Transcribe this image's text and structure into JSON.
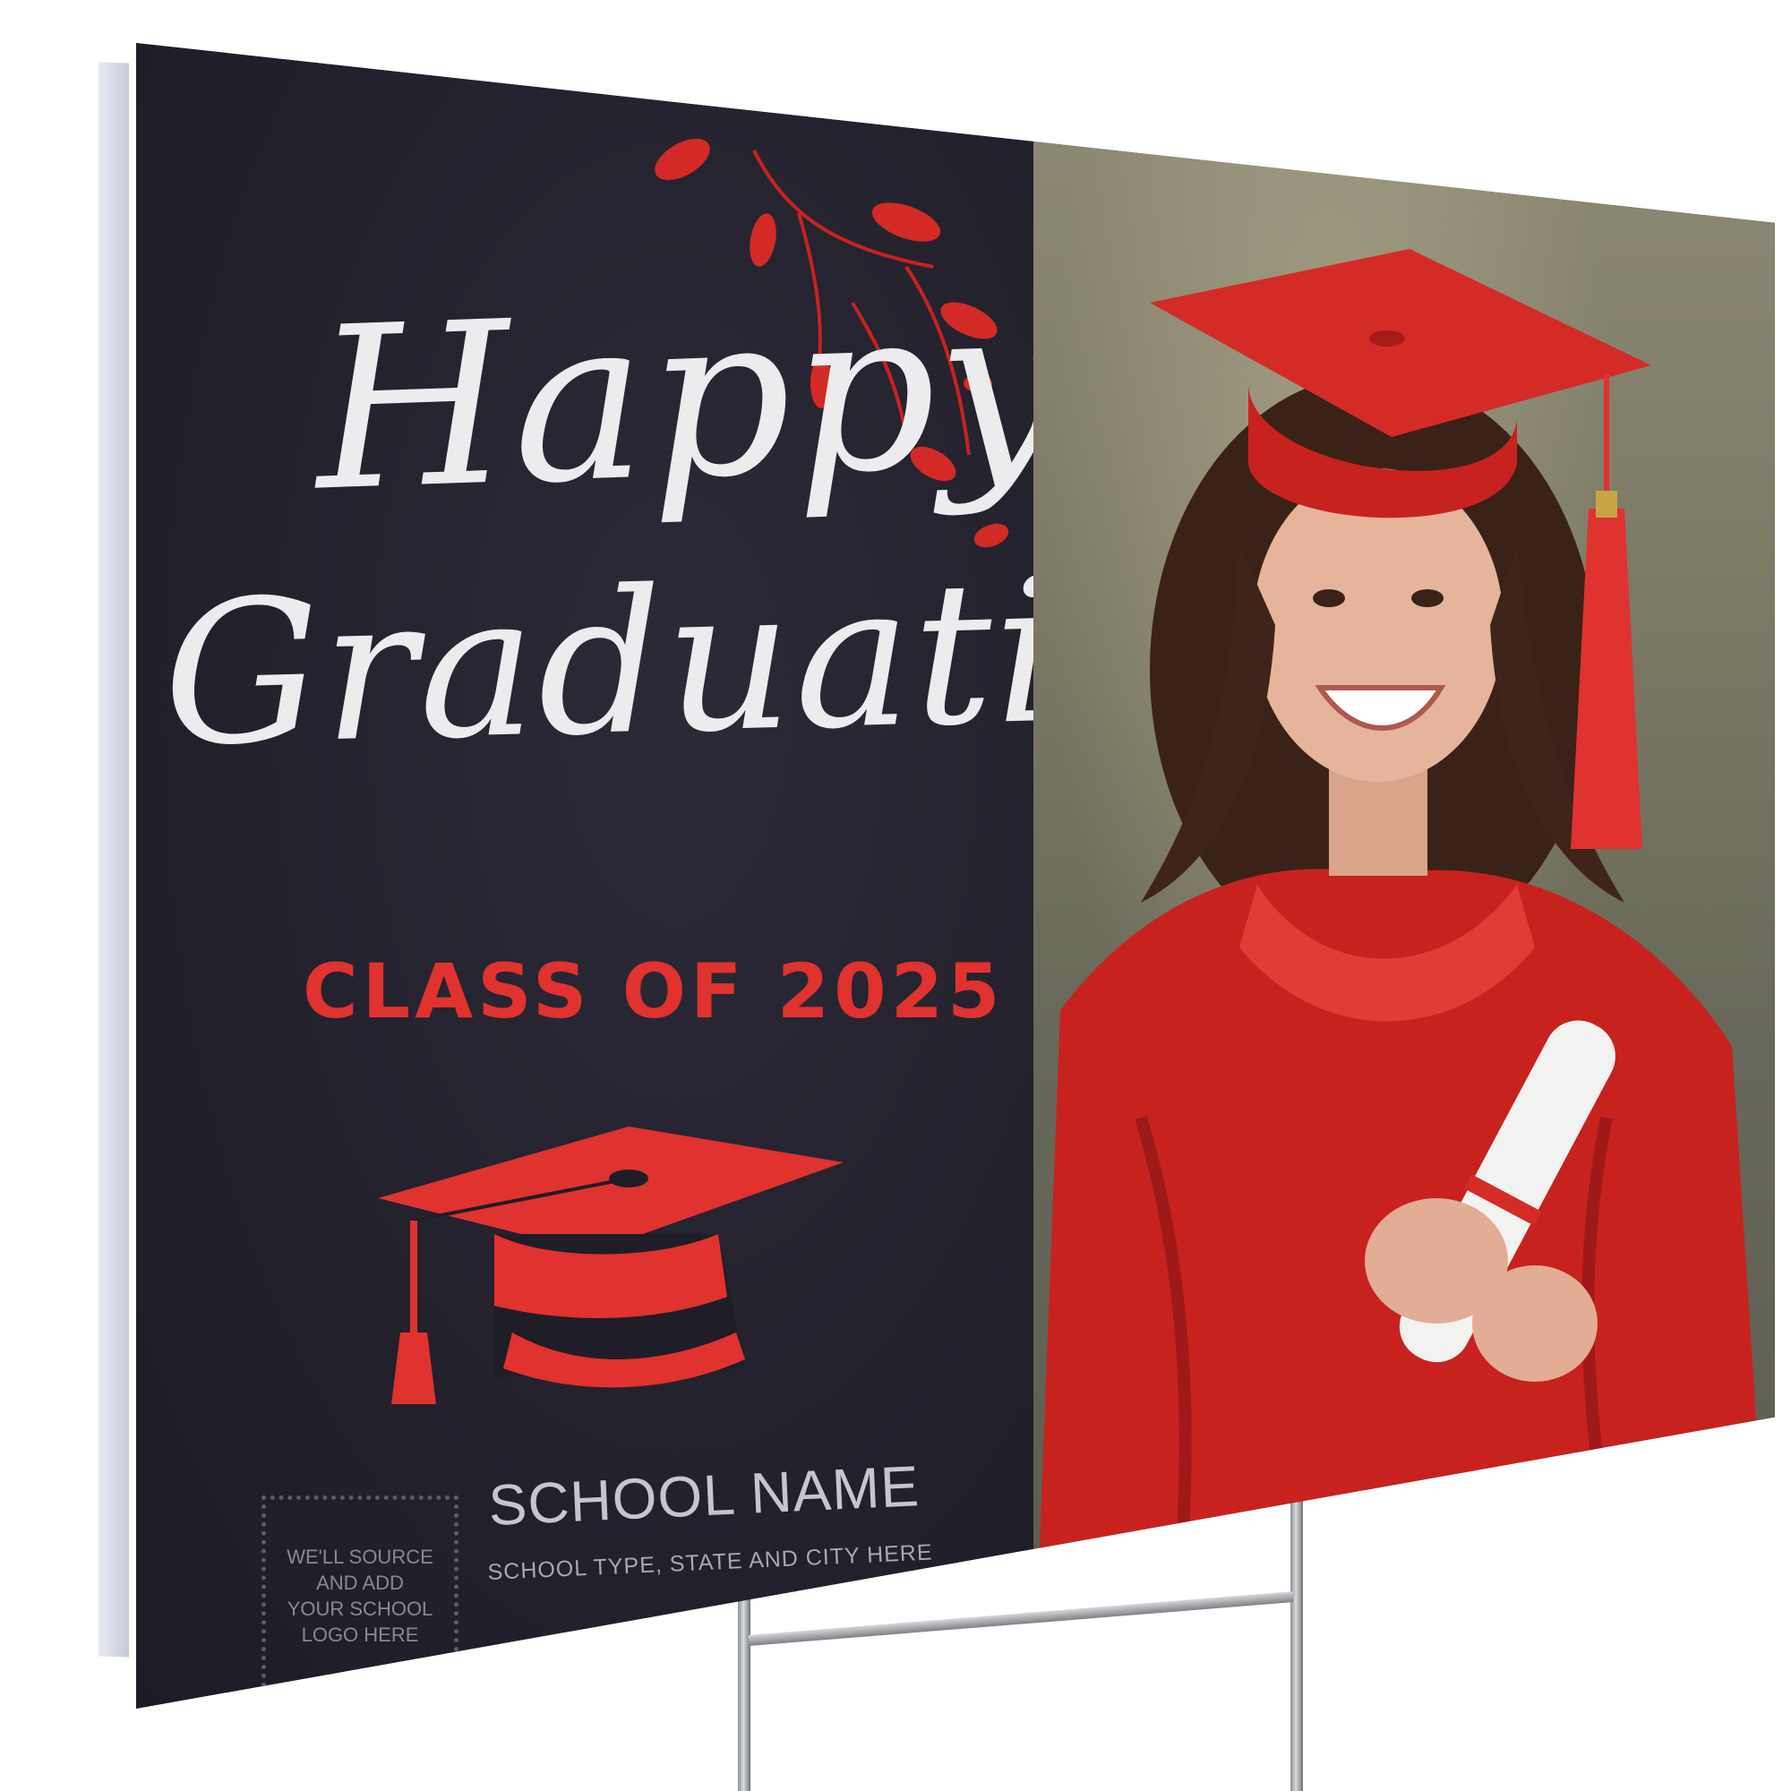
{
  "sign": {
    "headline_line1": "Happy",
    "headline_line2": "Graduation!",
    "class_year": "CLASS OF 2025",
    "logo_placeholder": "WE'LL SOURCE\nAND ADD\nYOUR SCHOOL\nLOGO HERE",
    "school_name": "SCHOOL NAME",
    "school_details": "SCHOOL TYPE, STATE AND CITY HERE"
  },
  "colors": {
    "board": "#24222e",
    "accent_red": "#e0322f",
    "script_text": "#ecebed"
  },
  "icons": [
    "graduation-cap-icon",
    "leaf-branch-decoration"
  ],
  "photo": {
    "subject": "graduate in red cap and gown holding diploma"
  }
}
